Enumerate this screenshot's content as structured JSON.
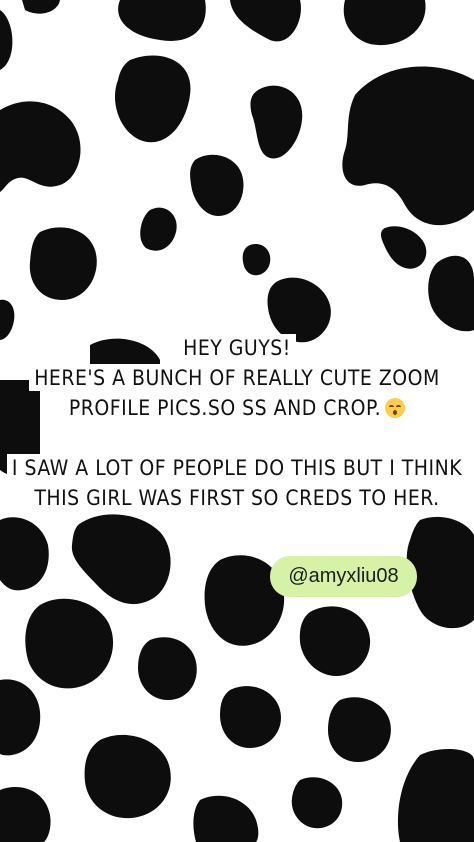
{
  "colors": {
    "background": "#ffffff",
    "spots": "#0d0d0d",
    "handle_bg": "#d6f2a6",
    "text": "#111111"
  },
  "caption": {
    "line1": "Hey guys!",
    "line2": "Here's a bunch of really cute Zoom",
    "line3": "profile pics.so ss and crop.",
    "emoji": "kissing-face-with-smiling-eyes",
    "line4": "I saw a lot of people do this but I think",
    "line5": "this girl was first so creds to her."
  },
  "handle": {
    "label": "@amyxliu08"
  }
}
